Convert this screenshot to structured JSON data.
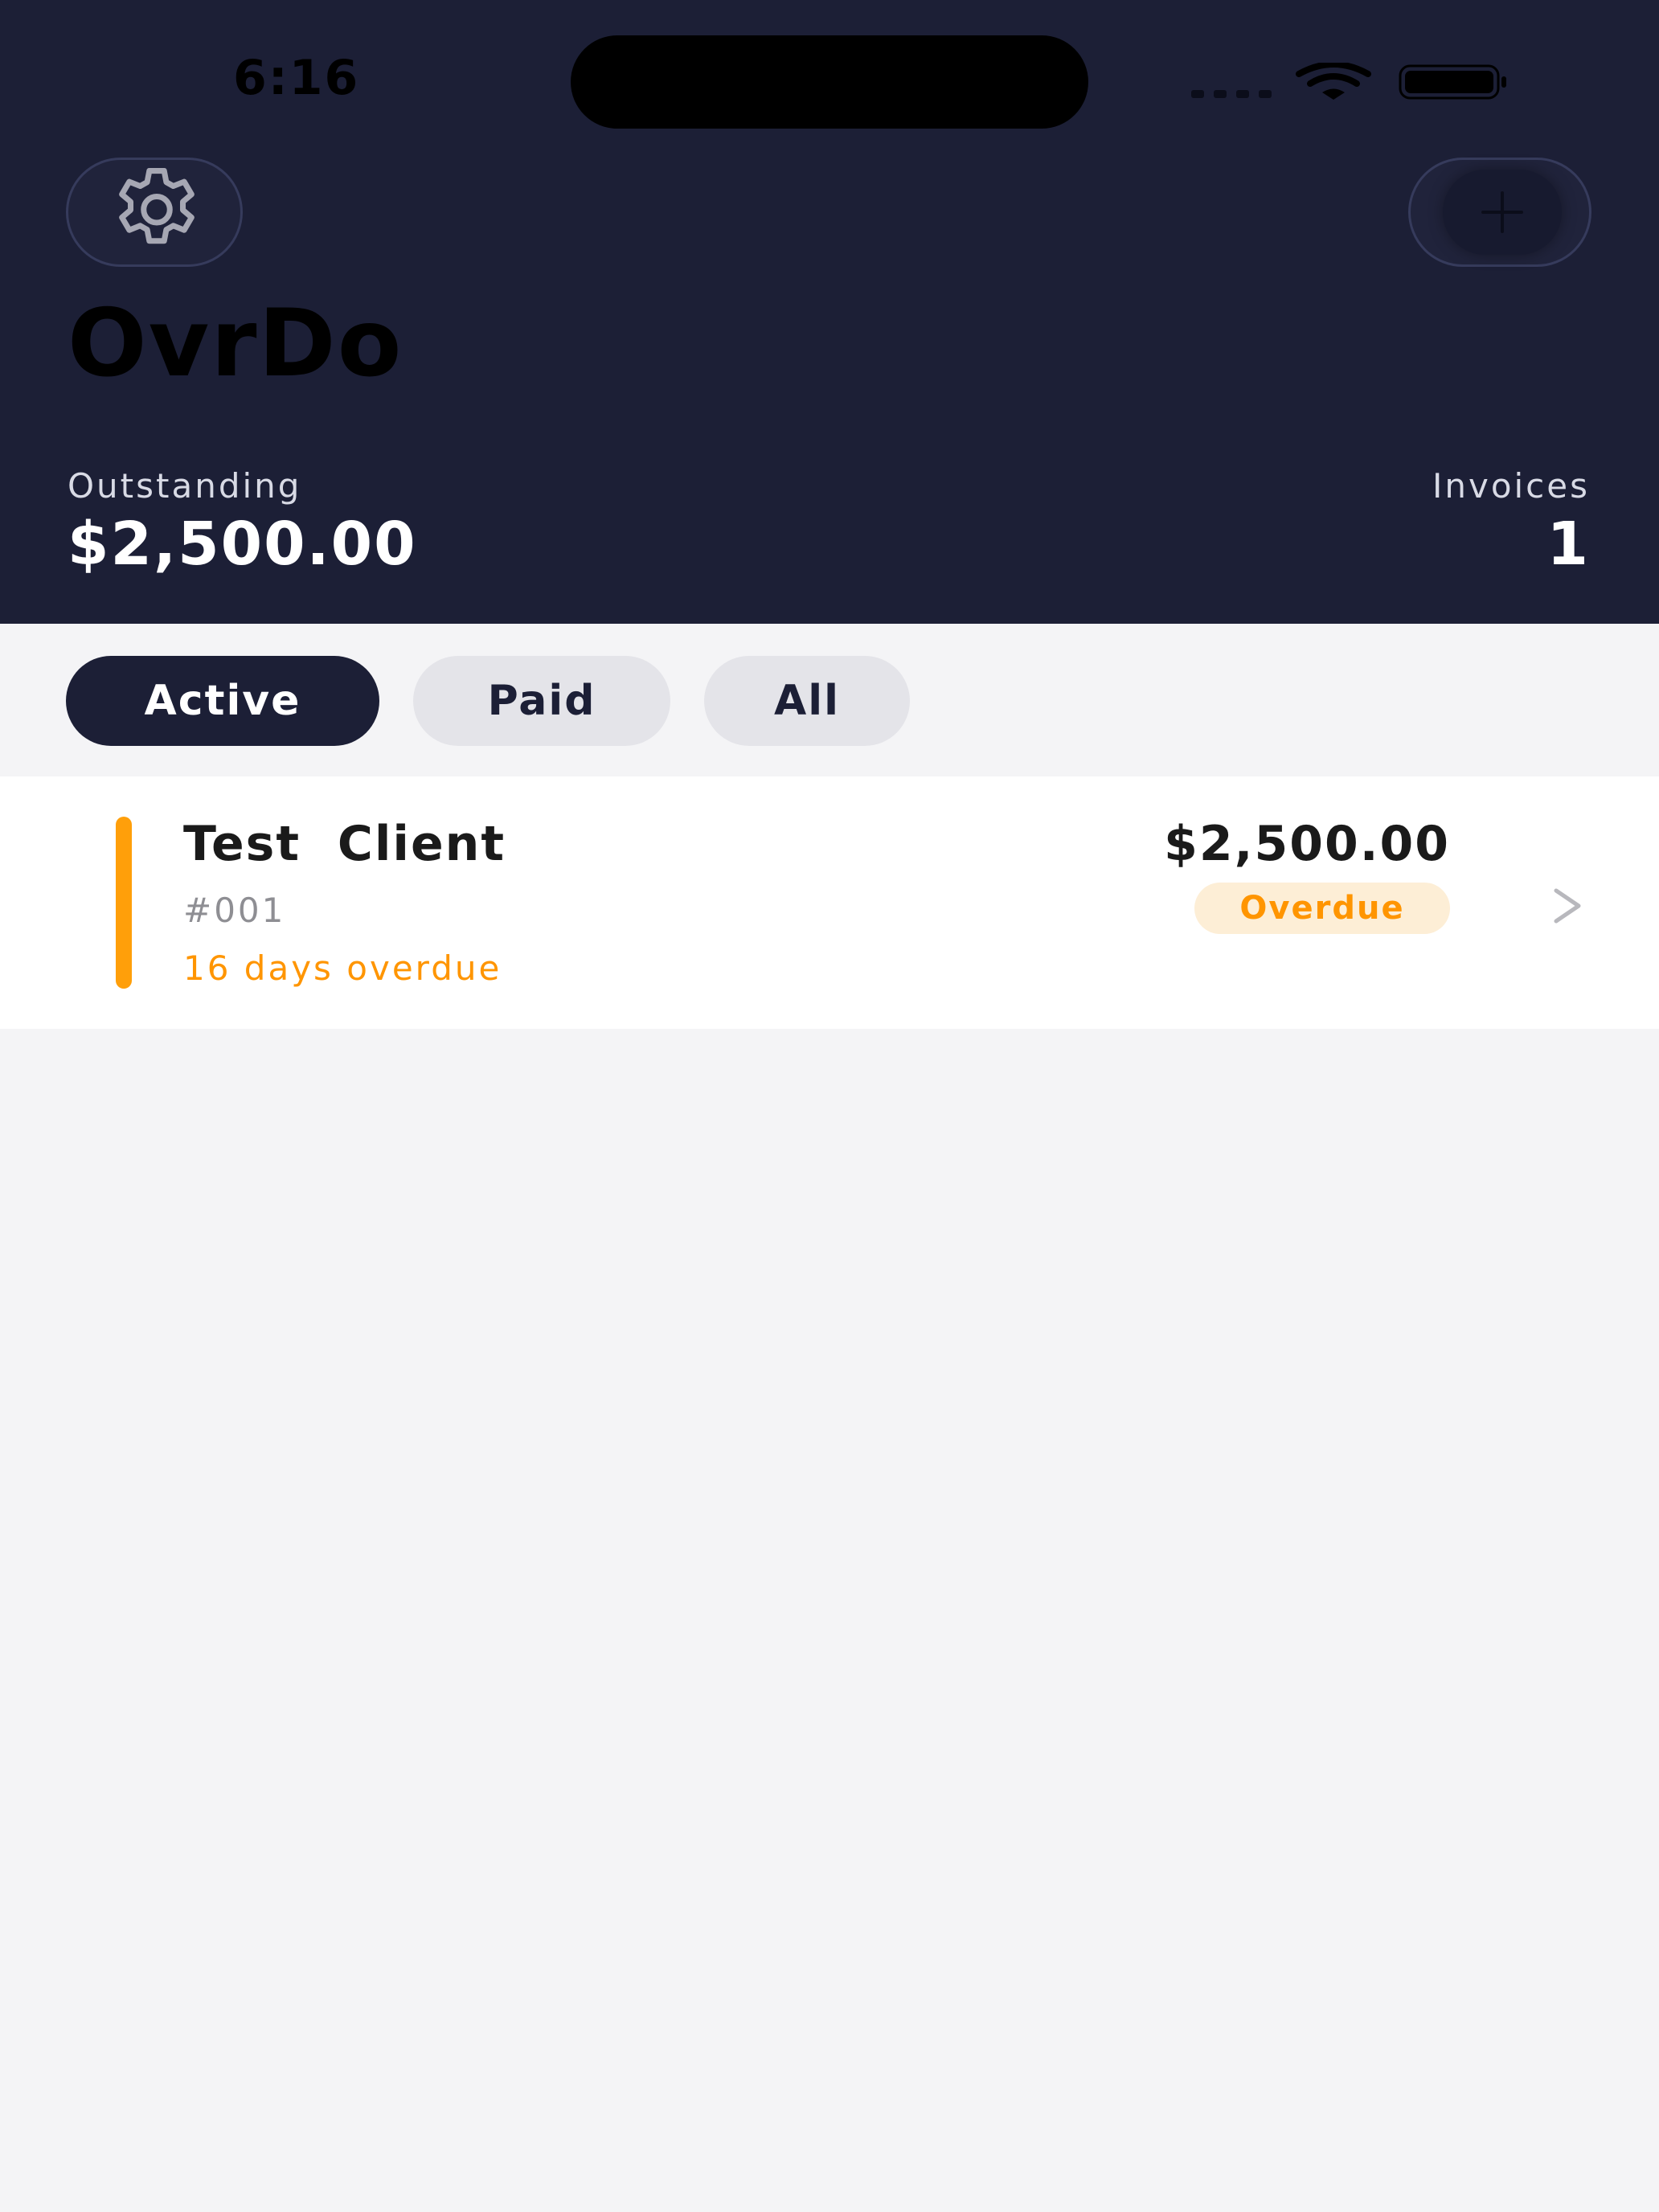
{
  "status_bar": {
    "time": "6:16"
  },
  "icons": {
    "settings": "gear-icon",
    "add": "plus-icon",
    "row_chevron": "chevron-right-icon"
  },
  "header": {
    "app_title": "OvrDo",
    "outstanding_label": "Outstanding",
    "outstanding_value": "$2,500.00",
    "invoices_label": "Invoices",
    "invoices_value": "1"
  },
  "filters": {
    "selected": "Active",
    "options": [
      "Active",
      "Paid",
      "All"
    ]
  },
  "invoices": [
    {
      "client": "Test  Client",
      "number": "#001",
      "overdue_text": "16 days overdue",
      "amount": "$2,500.00",
      "status": "Overdue"
    }
  ],
  "colors": {
    "header_bg": "#1c1f36",
    "accent_overdue": "#ff9500",
    "badge_bg": "#fdeed6",
    "chip_inactive": "#e4e4e9",
    "page_bg": "#f4f4f6"
  }
}
